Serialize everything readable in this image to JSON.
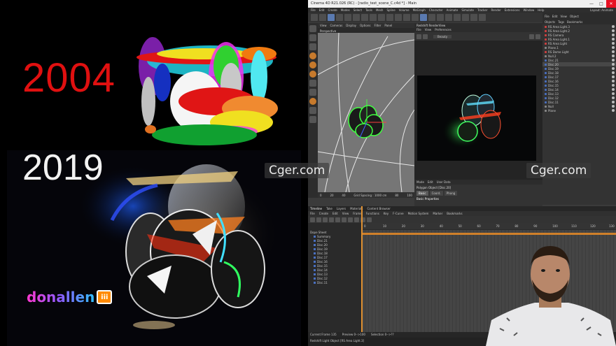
{
  "art": {
    "year_old": "2004",
    "year_new": "2019",
    "brand": "donallen",
    "brand_mark": "iii"
  },
  "watermark": "Cger.com",
  "window": {
    "title": "Cinema 4D R21.026 (RC) - [radio_test_scene_C.c4d *] - Main",
    "minimize": "—",
    "maximize": "□",
    "close": "✕"
  },
  "menubar": [
    "File",
    "Edit",
    "Create",
    "Modes",
    "Select",
    "Tools",
    "Mesh",
    "Spline",
    "Volume",
    "MoGraph",
    "Character",
    "Animate",
    "Simulate",
    "Tracker",
    "Render",
    "Extensions",
    "Window",
    "Help"
  ],
  "layout_label": "Layout: Animate",
  "viewport": {
    "menu": [
      "View",
      "Cameras",
      "Display",
      "Options",
      "Filter",
      "Panel"
    ],
    "label": "Perspective",
    "grid": "Grid Spacing : 1000 cm",
    "ticks": [
      "0",
      "10",
      "20",
      "30",
      "40",
      "50",
      "60",
      "70",
      "80",
      "90",
      "100"
    ]
  },
  "render_view": {
    "title": "Redshift RenderView",
    "menu": [
      "File",
      "View",
      "Preferences"
    ],
    "mode": "Beauty",
    "status": "Frame: 135   2020-10-17  17:03:45  (0.49s)"
  },
  "attributes": {
    "menu": [
      "Mode",
      "Edit",
      "User Data"
    ],
    "object": "Polygon Object [Disc.20]",
    "tabs": [
      "Basic",
      "Coord.",
      "Phong"
    ],
    "section": "Basic Properties"
  },
  "objects": {
    "header": [
      "File",
      "Edit",
      "View",
      "Object"
    ],
    "menu": [
      "Objects",
      "Tags",
      "Bookmarks"
    ],
    "rows": [
      {
        "name": "RS Area Light.3",
        "kind": "light"
      },
      {
        "name": "RS Area Light.2",
        "kind": "light"
      },
      {
        "name": "RS Camera",
        "kind": "light"
      },
      {
        "name": "RS Area Light.1",
        "kind": "light"
      },
      {
        "name": "RS Area Light",
        "kind": "light"
      },
      {
        "name": "Plane.1",
        "kind": "null"
      },
      {
        "name": "RS Dome Light",
        "kind": "light"
      },
      {
        "name": "Null.2",
        "kind": "null"
      },
      {
        "name": "Disc.21",
        "kind": "disc"
      },
      {
        "name": "Disc.20",
        "kind": "disc"
      },
      {
        "name": "Disc.19",
        "kind": "disc"
      },
      {
        "name": "Disc.18",
        "kind": "disc"
      },
      {
        "name": "Disc.17",
        "kind": "disc"
      },
      {
        "name": "Disc.16",
        "kind": "disc"
      },
      {
        "name": "Disc.15",
        "kind": "disc"
      },
      {
        "name": "Disc.14",
        "kind": "disc"
      },
      {
        "name": "Disc.13",
        "kind": "disc"
      },
      {
        "name": "Disc.12",
        "kind": "disc"
      },
      {
        "name": "Disc.11",
        "kind": "disc"
      },
      {
        "name": "Null",
        "kind": "null"
      },
      {
        "name": "Plane",
        "kind": "null"
      }
    ]
  },
  "timeline": {
    "tabs": [
      "Timeline",
      "Take",
      "Layers",
      "Materials",
      "Content Browser"
    ],
    "menu": [
      "File",
      "Create",
      "Edit",
      "View",
      "Frame",
      "Functions",
      "Key",
      "F-Curve",
      "Motion System",
      "Marker",
      "Bookmarks"
    ],
    "tree_title": "Dope Sheet",
    "tree_rows": [
      "Summary",
      "Disc.21",
      "Disc.20",
      "Disc.19",
      "Disc.18",
      "Disc.17",
      "Disc.16",
      "Disc.15",
      "Disc.14",
      "Disc.13",
      "Disc.12",
      "Disc.11"
    ],
    "ruler": [
      "0",
      "10",
      "20",
      "30",
      "40",
      "50",
      "60",
      "70",
      "80",
      "90",
      "100",
      "110",
      "120",
      "130"
    ],
    "status": [
      "Current Frame  135",
      "Preview  0-->100",
      "Selection  0-->??"
    ],
    "hint": "Redshift Light Object [RS Area Light.3]"
  },
  "colors": {
    "c4d_bg": "#3b3b3b",
    "accent_orange": "#d0802a",
    "year_old": "#e01010",
    "close_red": "#e81123"
  }
}
